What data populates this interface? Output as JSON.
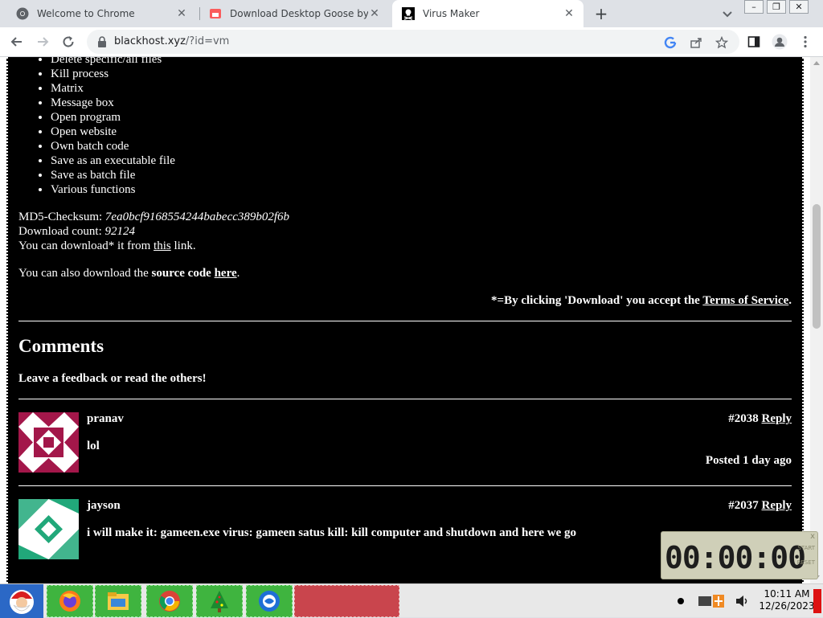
{
  "browser": {
    "tabs": [
      {
        "title": "Welcome to Chrome",
        "icon": "chrome-icon"
      },
      {
        "title": "Download Desktop Goose by sa",
        "icon": "itch-icon"
      },
      {
        "title": "Virus Maker",
        "icon": "skull-flag-icon"
      }
    ],
    "url_host": "blackhost.xyz",
    "url_path": "/?id=vm"
  },
  "features": [
    "Delete specific/all files",
    "Kill process",
    "Matrix",
    "Message box",
    "Open program",
    "Open website",
    "Own batch code",
    "Save as an executable file",
    "Save as batch file",
    "Various functions"
  ],
  "info": {
    "checksum_label": "MD5-Checksum:",
    "checksum_value": "7ea0bcf9168554244babecc389b02f6b",
    "download_label": "Download count:",
    "download_value": "92124",
    "download_pre": "You can download* it from",
    "download_link": "this",
    "download_post": "link.",
    "source_pre": "You can also download the",
    "source_bold": "source code",
    "source_link": "here",
    "source_post": ".",
    "tos_pre": "*=By clicking 'Download' you accept the",
    "tos_link": "Terms of Service",
    "tos_post": "."
  },
  "comments_section": {
    "heading": "Comments",
    "subheading": "Leave a feedback or read the others!",
    "reply_label": "Reply",
    "items": [
      {
        "name": "pranav",
        "number": "#2038",
        "text": "lol",
        "posted": "Posted 1 day ago",
        "avatar_color": "#a3174a"
      },
      {
        "name": "jayson",
        "number": "#2037",
        "text": "i will make it: gameen.exe virus: gameen satus kill: kill computer and shutdown and here we go",
        "posted": "",
        "avatar_color": "#21a87a"
      }
    ]
  },
  "timer": {
    "display": "00:00:00",
    "start_label": "START",
    "reset_label": "RESET",
    "close": "x"
  },
  "taskbar": {
    "time": "10:11 AM",
    "date": "12/26/2023"
  }
}
